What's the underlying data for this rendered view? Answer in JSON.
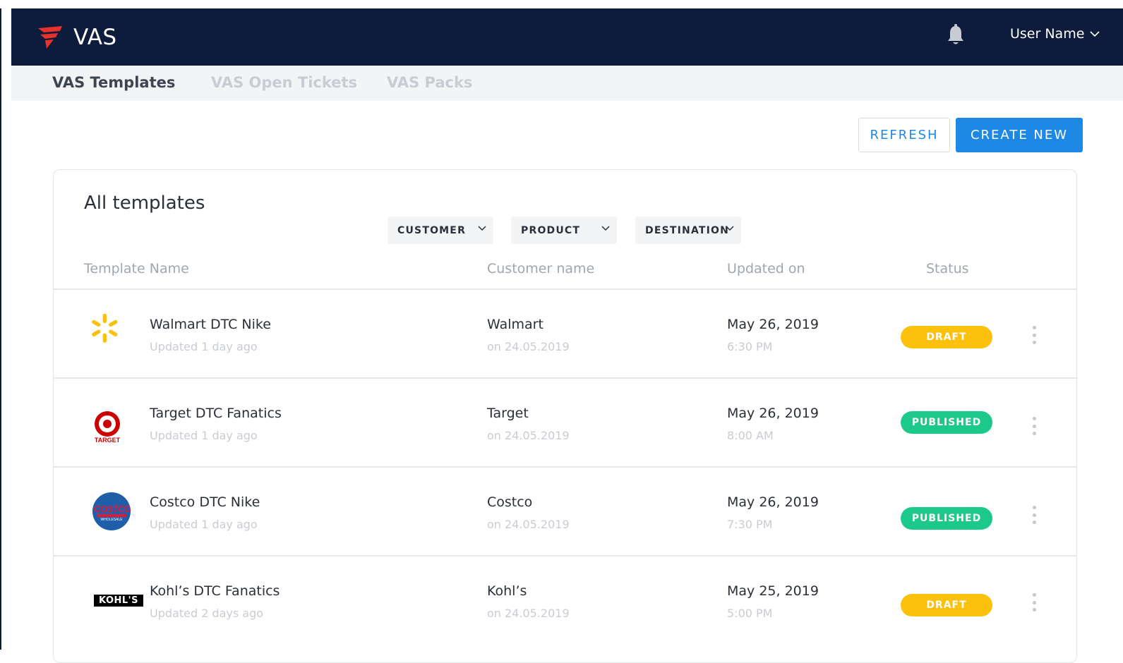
{
  "app": {
    "brand": "VAS",
    "user_name": "User Name"
  },
  "tabs": [
    {
      "label": "VAS Templates",
      "active": true
    },
    {
      "label": "VAS Open Tickets",
      "active": false
    },
    {
      "label": "VAS Packs",
      "active": false
    }
  ],
  "actions": {
    "refresh_label": "REFRESH",
    "create_label": "CREATE NEW"
  },
  "card": {
    "title": "All templates",
    "filters": [
      "CUSTOMER",
      "PRODUCT",
      "DESTINATION"
    ],
    "columns": [
      "Template Name",
      "Customer name",
      "Updated on",
      "Status"
    ]
  },
  "rows": [
    {
      "logo": "walmart-logo",
      "name": "Walmart DTC Nike",
      "updated_ago": "Updated 1 day ago",
      "customer": "Walmart",
      "customer_date": "on 24.05.2019",
      "date": "May 26, 2019",
      "time": "6:30 PM",
      "status": "DRAFT"
    },
    {
      "logo": "target-logo",
      "logo_text": "TARGET",
      "name": "Target DTC Fanatics",
      "updated_ago": "Updated 1 day ago",
      "customer": "Target",
      "customer_date": "on 24.05.2019",
      "date": "May 26, 2019",
      "time": "8:00 AM",
      "status": "PUBLISHED"
    },
    {
      "logo": "costco-logo",
      "logo_text": "COSTCO",
      "logo_subtext": "WHOLESALE",
      "name": "Costco DTC Nike",
      "updated_ago": "Updated 1 day ago",
      "customer": "Costco",
      "customer_date": "on 24.05.2019",
      "date": "May 26, 2019",
      "time": "7:30 PM",
      "status": "PUBLISHED"
    },
    {
      "logo": "kohls-logo",
      "logo_text": "KOHL'S",
      "name": "Kohl’s DTC Fanatics",
      "updated_ago": "Updated 2 days ago",
      "customer": "Kohl’s",
      "customer_date": "on 24.05.2019",
      "date": "May 25, 2019",
      "time": "5:00 PM",
      "status": "DRAFT"
    }
  ],
  "colors": {
    "topbar": "#0d1c3d",
    "accent": "#1e88e5",
    "draft": "#fcc10c",
    "published": "#1cc88a",
    "logo_red": "#e8322b"
  },
  "icons": [
    "brand-logo-icon",
    "bell-icon",
    "chevron-down-icon",
    "kebab-menu-icon"
  ]
}
